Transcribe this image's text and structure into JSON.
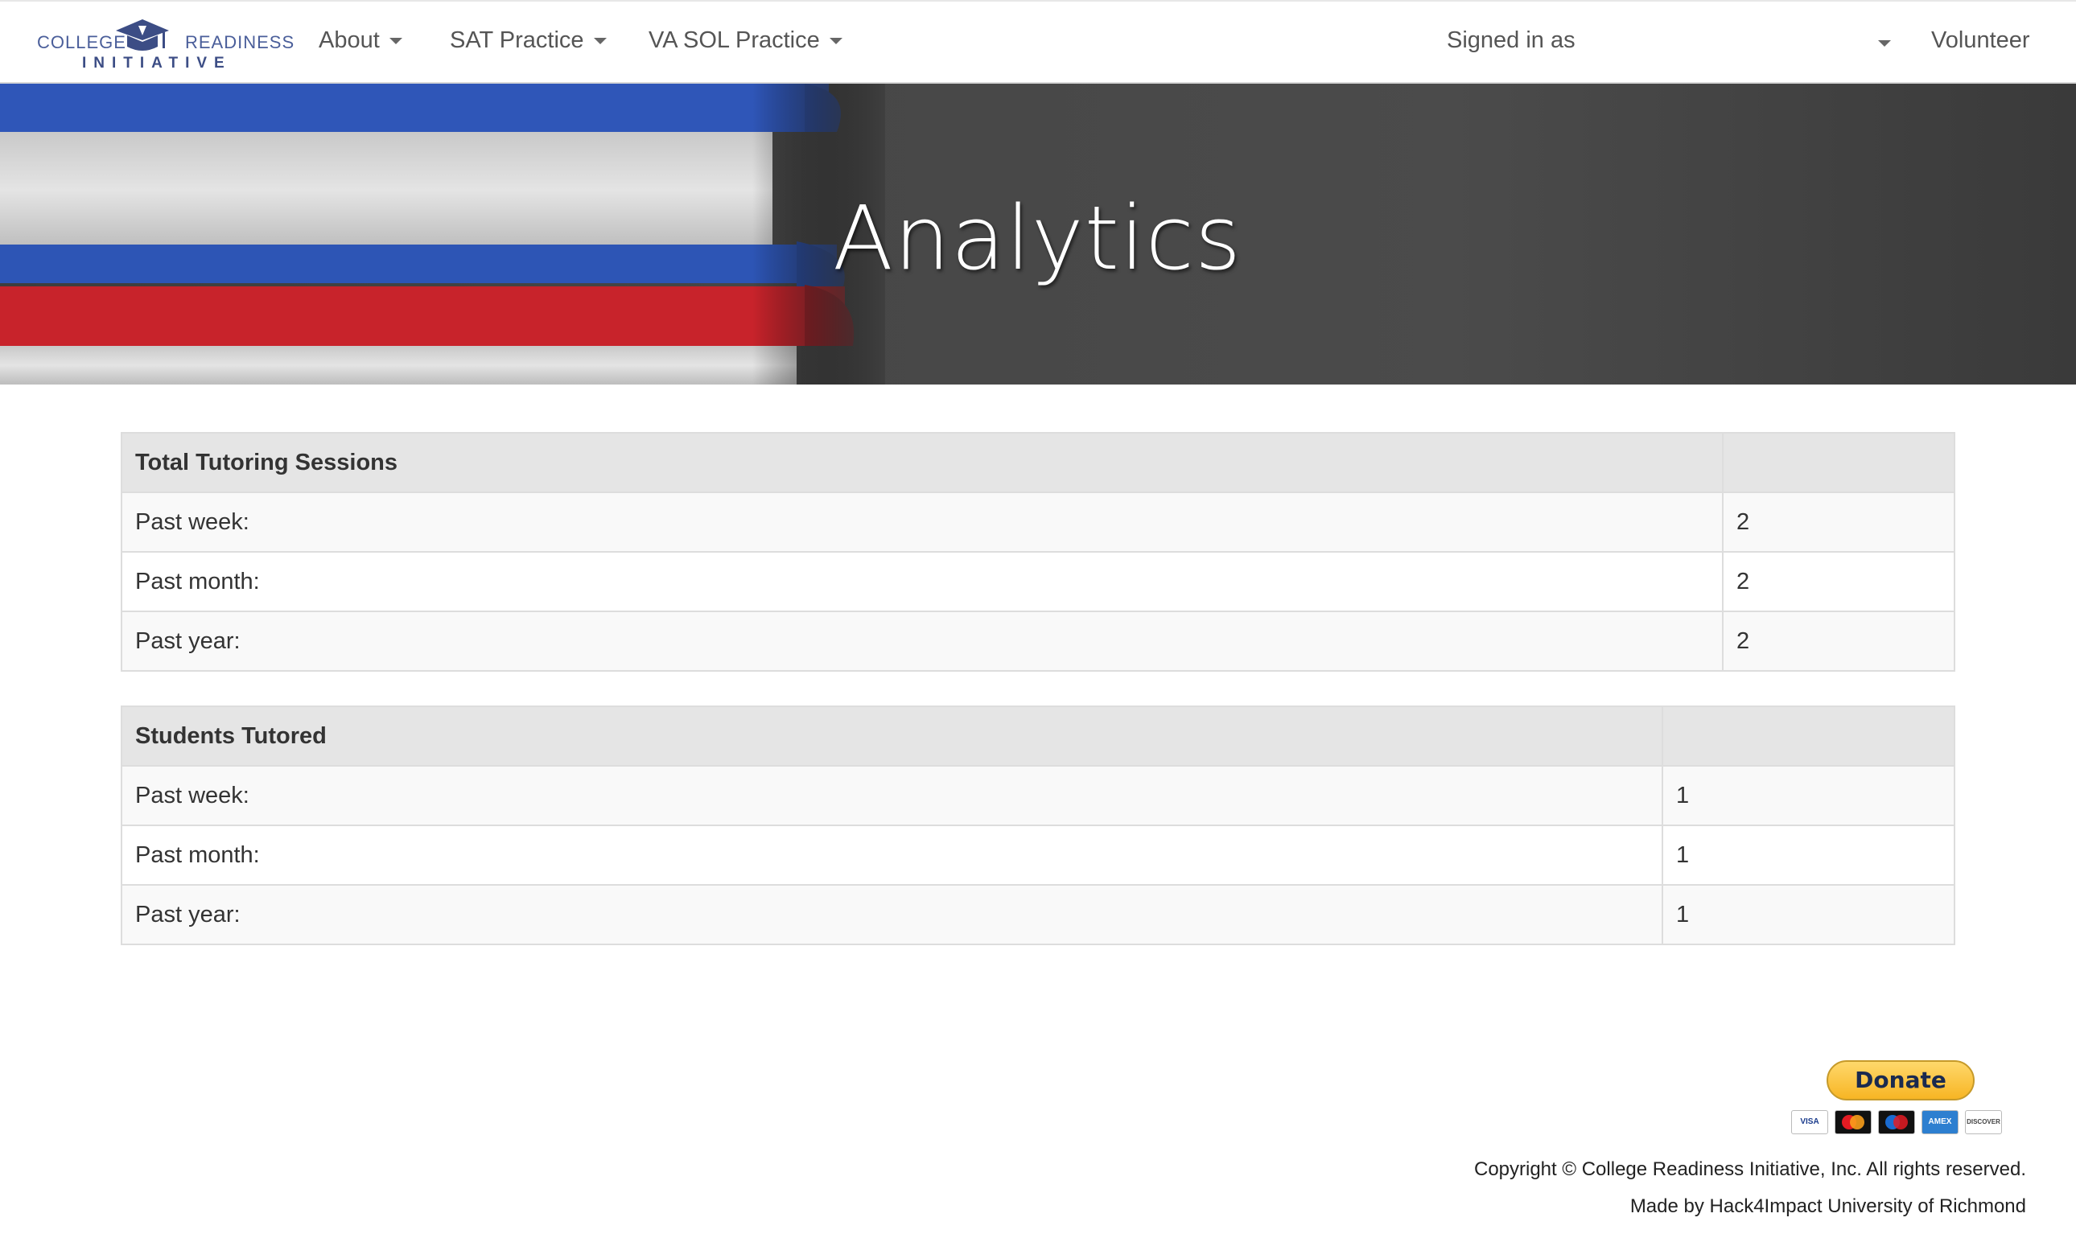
{
  "brand": {
    "word_left": "COLLEGE",
    "word_right": "READINESS",
    "word_bottom": "INITIATIVE",
    "color": "#4a5e9a"
  },
  "nav": {
    "items": [
      {
        "label": "About",
        "icon": "chevron-down-icon"
      },
      {
        "label": "SAT Practice",
        "icon": "chevron-down-icon"
      },
      {
        "label": "VA SOL Practice",
        "icon": "chevron-down-icon"
      }
    ],
    "signed_in_label": "Signed in as",
    "role_label": "Volunteer"
  },
  "hero": {
    "title": "Analytics"
  },
  "tables": [
    {
      "header": "Total Tutoring Sessions",
      "rows": [
        {
          "label": "Past week:",
          "value": "2"
        },
        {
          "label": "Past month:",
          "value": "2"
        },
        {
          "label": "Past year:",
          "value": "2"
        }
      ]
    },
    {
      "header": "Students Tutored",
      "rows": [
        {
          "label": "Past week:",
          "value": "1"
        },
        {
          "label": "Past month:",
          "value": "1"
        },
        {
          "label": "Past year:",
          "value": "1"
        }
      ]
    }
  ],
  "footer": {
    "donate_label": "Donate",
    "cards": [
      "VISA",
      "mastercard",
      "maestro",
      "AMEX",
      "DISCOVER"
    ],
    "copyright": "Copyright © College Readiness Initiative, Inc. All rights reserved.",
    "made_by": "Made by Hack4Impact University of Richmond"
  }
}
